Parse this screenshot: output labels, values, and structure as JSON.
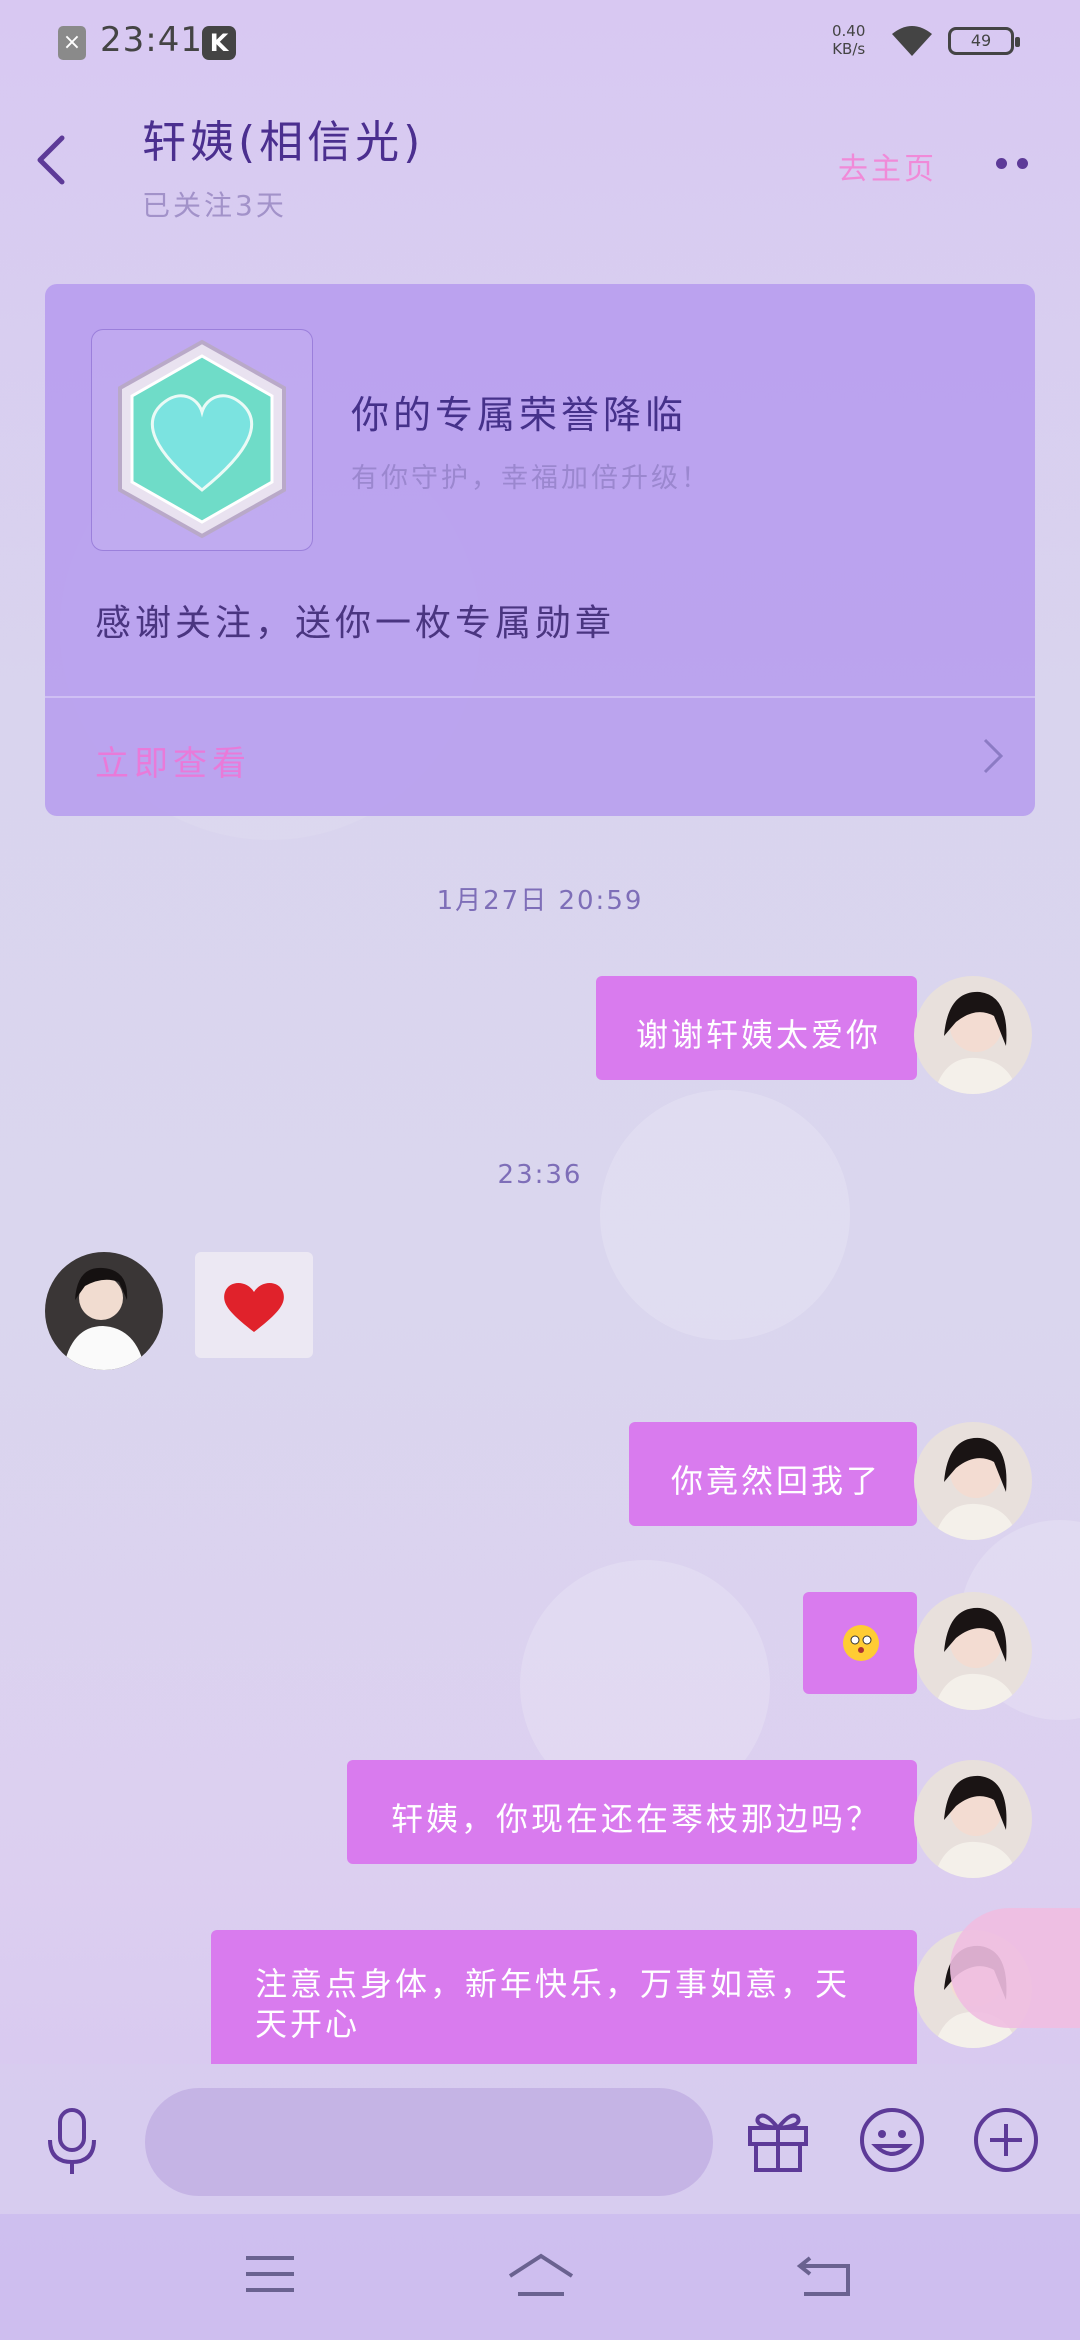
{
  "status_bar": {
    "time": "23:41",
    "net_speed_value": "0.40",
    "net_speed_unit": "KB/s",
    "battery": "49"
  },
  "header": {
    "title": "轩姨(相信光)",
    "subtitle": "已关注3天",
    "homepage_link": "去主页"
  },
  "honor_card": {
    "title": "你的专属荣誉降临",
    "subtitle": "有你守护，幸福加倍升级！",
    "message": "感谢关注，送你一枚专属勋章",
    "action": "立即查看",
    "badge_color": "#6fdcc8"
  },
  "messages": [
    {
      "type": "timestamp",
      "text": "1月27日 20:59"
    },
    {
      "type": "sent",
      "text": "谢谢轩姨太爱你"
    },
    {
      "type": "timestamp",
      "text": "23:36"
    },
    {
      "type": "received",
      "emoji": "❤️"
    },
    {
      "type": "sent",
      "text": "你竟然回我了"
    },
    {
      "type": "sent",
      "emoji": "😳"
    },
    {
      "type": "sent",
      "text": "轩姨，你现在还在琴枝那边吗？"
    },
    {
      "type": "sent",
      "text": "注意点身体，新年快乐，万事如意，天天开心"
    }
  ],
  "colors": {
    "sent_bubble": "#d97bee",
    "accent_text": "#4b2f8f",
    "link_pink": "#e97ad9"
  }
}
